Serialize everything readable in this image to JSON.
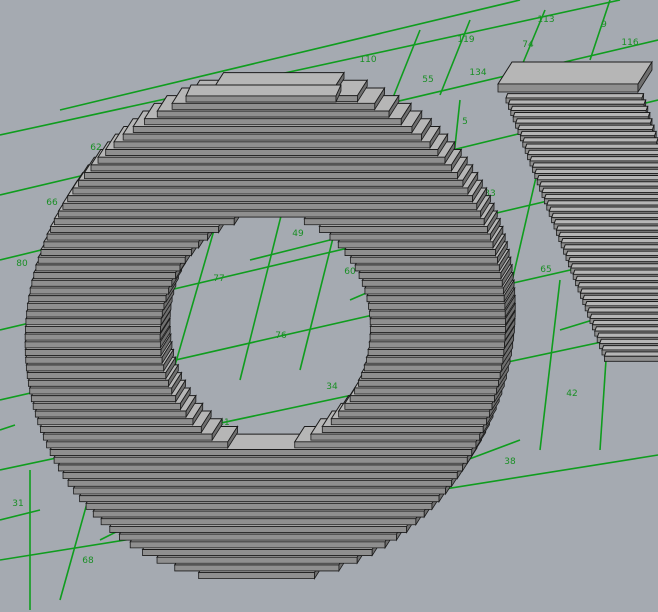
{
  "viewport": {
    "background": "#a5aab1",
    "grid_color": "#0f9d1e",
    "label_color": "#1a8f25",
    "slab_top_color": "#b6b6b6",
    "slab_edge_color": "#1b1b1b",
    "icon": "3d-stacked-slab-letters"
  },
  "cell_labels": [
    "68",
    "31",
    "21",
    "34",
    "38",
    "42",
    "76",
    "77",
    "60",
    "49",
    "80",
    "65",
    "66",
    "62",
    "5",
    "55",
    "134",
    "119",
    "110",
    "113",
    "116",
    "74",
    "9",
    "33"
  ]
}
